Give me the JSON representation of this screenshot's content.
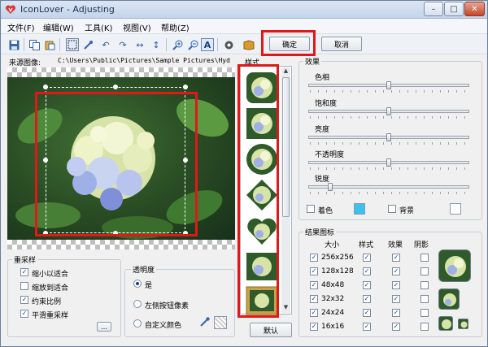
{
  "window": {
    "title": "IconLover - Adjusting",
    "minimize": "–",
    "maximize": "□",
    "close": "✕"
  },
  "menu": [
    "文件(F)",
    "编辑(W)",
    "工具(K)",
    "视图(V)",
    "帮助(Z)"
  ],
  "toolbar": {
    "icons": [
      "save-icon",
      "copy-icon",
      "paste-icon",
      "select-rect-icon",
      "pipette-icon",
      "rotate-left-icon",
      "rotate-right-icon",
      "flip-horizontal-icon",
      "flip-vertical-icon",
      "zoom-in-icon",
      "zoom-out-icon",
      "text-icon",
      "preview-icon",
      "book-icon"
    ],
    "ok_label": "确定",
    "cancel_label": "取消"
  },
  "source": {
    "label": "来源图像:",
    "path": "C:\\Users\\Public\\Pictures\\Sample Pictures\\Hyd"
  },
  "resample": {
    "title": "重采样",
    "options": [
      {
        "label": "缩小以适合",
        "checked": true
      },
      {
        "label": "缩放到适合",
        "checked": false
      },
      {
        "label": "约束比例",
        "checked": true
      },
      {
        "label": "平滑重采样",
        "checked": true
      }
    ],
    "more_label": "..."
  },
  "transparency": {
    "title": "透明度",
    "options": [
      {
        "label": "是",
        "selected": true
      },
      {
        "label": "左侧按钮像素",
        "selected": false
      },
      {
        "label": "自定义颜色",
        "selected": false
      }
    ]
  },
  "styles": {
    "title": "样式",
    "items": [
      "style-round-rect",
      "style-square",
      "style-circle",
      "style-diamond",
      "style-heart",
      "style-rect",
      "style-frame"
    ],
    "default_label": "默认"
  },
  "effects": {
    "title": "效果",
    "sliders": [
      {
        "label": "色相",
        "value": 0.5
      },
      {
        "label": "饱和度",
        "value": 0.5
      },
      {
        "label": "亮度",
        "value": 0.5
      },
      {
        "label": "不透明度",
        "value": 0.5
      },
      {
        "label": "锐度",
        "value": 0.0
      }
    ],
    "colorize_label": "着色",
    "colorize_color": "#3cc0ec",
    "background_label": "背景",
    "background_color": "#ffffff"
  },
  "result_icons": {
    "title": "结果图标",
    "headers": [
      "大小",
      "样式",
      "效果",
      "阴影"
    ],
    "rows": [
      {
        "size": "256x256",
        "size_checked": true,
        "style": true,
        "effect": true,
        "shadow": false
      },
      {
        "size": "128x128",
        "size_checked": true,
        "style": true,
        "effect": true,
        "shadow": false
      },
      {
        "size": "48x48",
        "size_checked": true,
        "style": true,
        "effect": true,
        "shadow": false
      },
      {
        "size": "32x32",
        "size_checked": true,
        "style": true,
        "effect": true,
        "shadow": false
      },
      {
        "size": "24x24",
        "size_checked": true,
        "style": true,
        "effect": true,
        "shadow": false
      },
      {
        "size": "16x16",
        "size_checked": true,
        "style": true,
        "effect": true,
        "shadow": false
      }
    ]
  },
  "colors": {
    "highlight": "#e01818",
    "accent": "#3cc0ec"
  }
}
